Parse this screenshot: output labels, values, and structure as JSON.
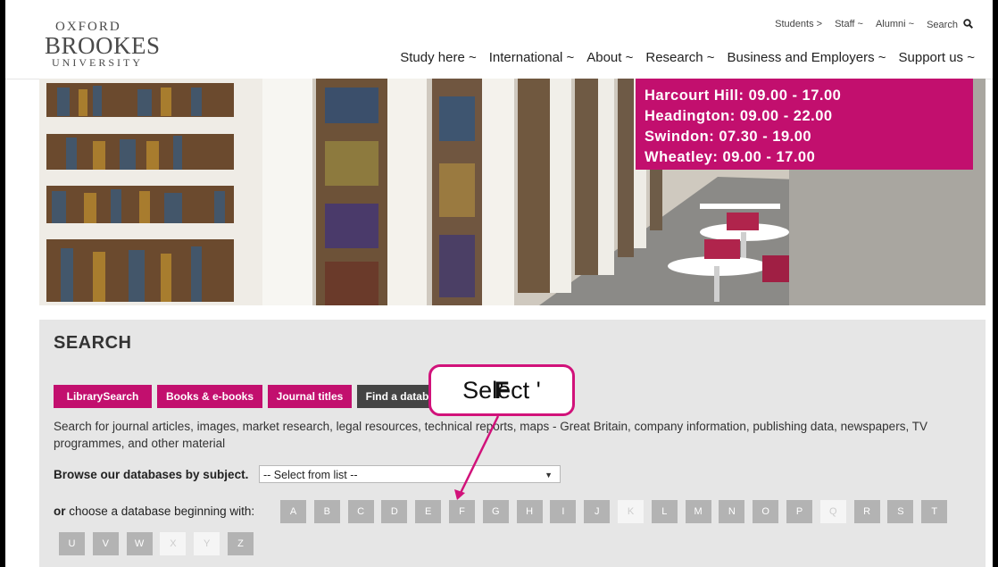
{
  "logo": {
    "line1": "OXFORD",
    "line2": "BROOKES",
    "line3": "UNIVERSITY"
  },
  "utility_nav": {
    "students": "Students >",
    "staff": "Staff ~",
    "alumni": "Alumni ~",
    "search": "Search"
  },
  "main_nav": [
    "Study here ~",
    "International ~",
    "About ~",
    "Research ~",
    "Business and Employers ~",
    "Support us ~"
  ],
  "opening_hours": [
    "Harcourt Hill: 09.00 - 17.00",
    "Headington: 09.00 - 22.00",
    "Swindon: 07.30 - 19.00",
    "Wheatley: 09.00 - 17.00"
  ],
  "search": {
    "title": "SEARCH",
    "tabs": [
      "LibrarySearch",
      "Books & e-books",
      "Journal titles",
      "Find a database"
    ],
    "description": "Search for journal articles, images, market research, legal resources, technical reports, maps - Great Britain, company information, publishing data, newspapers, TV programmes, and other material",
    "browse_label": "Browse our databases by subject.",
    "browse_select_value": "-- Select from list --",
    "choose_prefix": "or",
    "choose_label": " choose a database beginning with:",
    "letters_row1": [
      "A",
      "B",
      "C",
      "D",
      "E",
      "F",
      "G",
      "H",
      "I",
      "J",
      "K",
      "L",
      "M",
      "N",
      "O",
      "P",
      "Q",
      "R",
      "S",
      "T"
    ],
    "letters_row2": [
      "U",
      "V",
      "W",
      "X",
      "Y",
      "Z"
    ],
    "disabled_letters": [
      "K",
      "Q",
      "X",
      "Y"
    ]
  },
  "callout": {
    "prefix": "Select '",
    "letter": "F",
    "suffix": "'"
  },
  "colors": {
    "brand_magenta": "#c20f6e",
    "letter_grey": "#b3b3b3",
    "panel_grey": "#e6e6e6"
  }
}
